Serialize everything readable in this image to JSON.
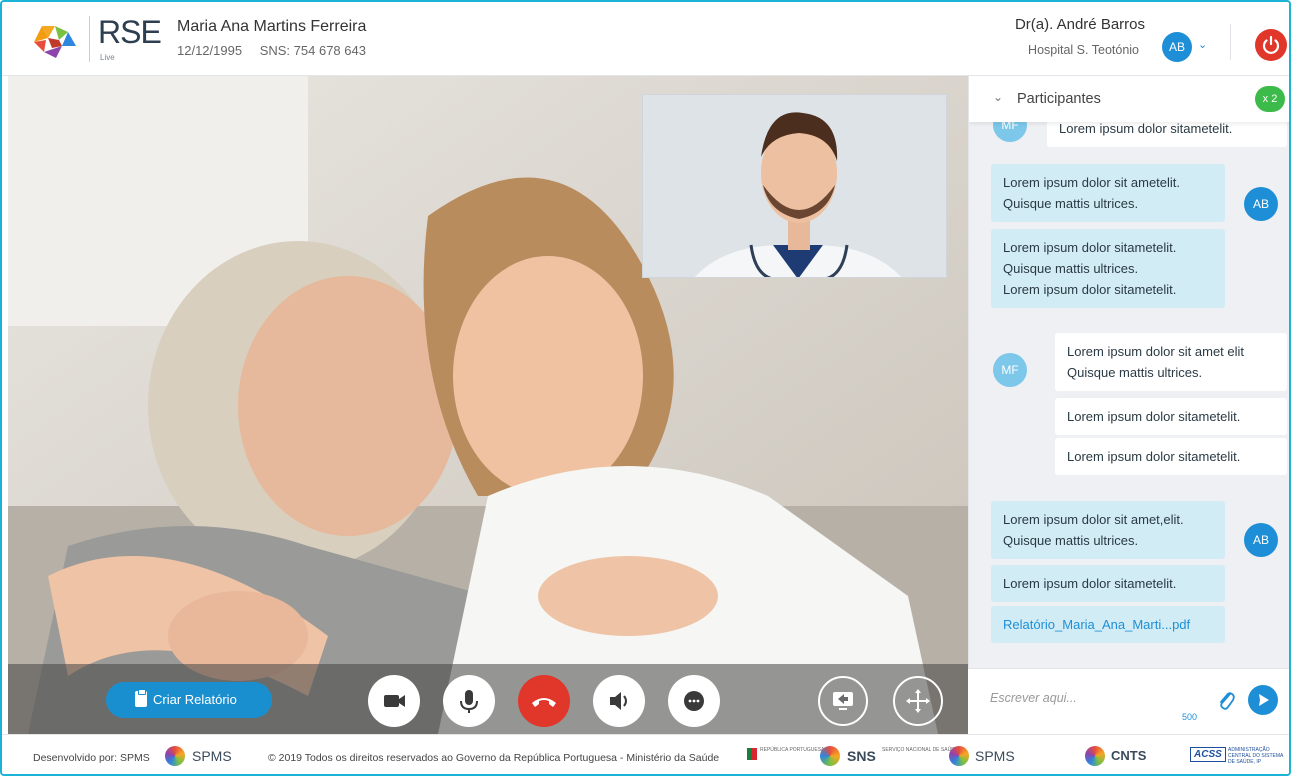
{
  "header": {
    "logo_text": "RSE",
    "logo_sub": "Live",
    "patient_name": "Maria Ana Martins Ferreira",
    "patient_dob": "12/12/1995",
    "patient_sns": "SNS: 754 678 643",
    "doctor_name": "Dr(a). André Barros",
    "doctor_hospital": "Hospital S. Teotónio",
    "doctor_initials": "AB"
  },
  "video": {
    "criar_relatorio_label": "Criar Relatório",
    "controls": [
      "camera-icon",
      "microphone-icon",
      "hang-up-icon",
      "speaker-icon",
      "chat-icon",
      "screen-share-icon",
      "move-icon"
    ]
  },
  "chat": {
    "participants_label": "Participantes",
    "participants_count": "x 2",
    "partial_avatar": "MF",
    "partial_message": "Lorem ipsum dolor sitametelit.",
    "messages": [
      {
        "author": "AB",
        "side": "self",
        "text_lines": [
          "Lorem ipsum dolor sit ametelit.",
          "Quisque mattis ultrices."
        ]
      },
      {
        "author": "AB",
        "side": "self",
        "text_lines": [
          "Lorem ipsum dolor sitametelit.",
          "Quisque mattis ultrices.",
          "Lorem ipsum dolor sitametelit."
        ]
      },
      {
        "author": "MF",
        "side": "other",
        "text_lines": [
          "Lorem ipsum dolor sit amet elit",
          "Quisque mattis ultrices."
        ]
      },
      {
        "author": "MF",
        "side": "other",
        "text_lines": [
          "Lorem ipsum dolor sitametelit."
        ]
      },
      {
        "author": "MF",
        "side": "other",
        "text_lines": [
          "Lorem ipsum dolor sitametelit."
        ]
      },
      {
        "author": "AB",
        "side": "self",
        "text_lines": [
          "Lorem ipsum dolor sit amet,elit.",
          "Quisque mattis ultrices."
        ]
      },
      {
        "author": "AB",
        "side": "self",
        "text_lines": [
          "Lorem ipsum dolor sitametelit."
        ]
      },
      {
        "author": "AB",
        "side": "self",
        "text_lines": [
          "Relatório_Maria_Ana_Marti...pdf"
        ]
      }
    ],
    "composer_placeholder": "Escrever aqui...",
    "composer_counter": "500"
  },
  "footer": {
    "developed_by": "Desenvolvido por: SPMS",
    "spms_logo": "SPMS",
    "copyright": "© 2019 Todos os direitos reservados ao Governo da República Portuguesa - Ministério da Saúde",
    "republica": "REPÚBLICA PORTUGUESA",
    "sns_logo": "SNS",
    "sns_sub": "SERVIÇO NACIONAL DE SAÚDE",
    "spms_logo_2": "SPMS",
    "cnts_logo": "CNTS",
    "acss_logo": "ACSS",
    "acss_sub": "ADMINISTRAÇÃO CENTRAL DO SISTEMA DE SAÚDE, IP"
  },
  "colors": {
    "accent": "#1e8fd6",
    "hangup": "#e0372a",
    "badge": "#3dbb4a",
    "bubble_self": "#d2ecf5"
  }
}
